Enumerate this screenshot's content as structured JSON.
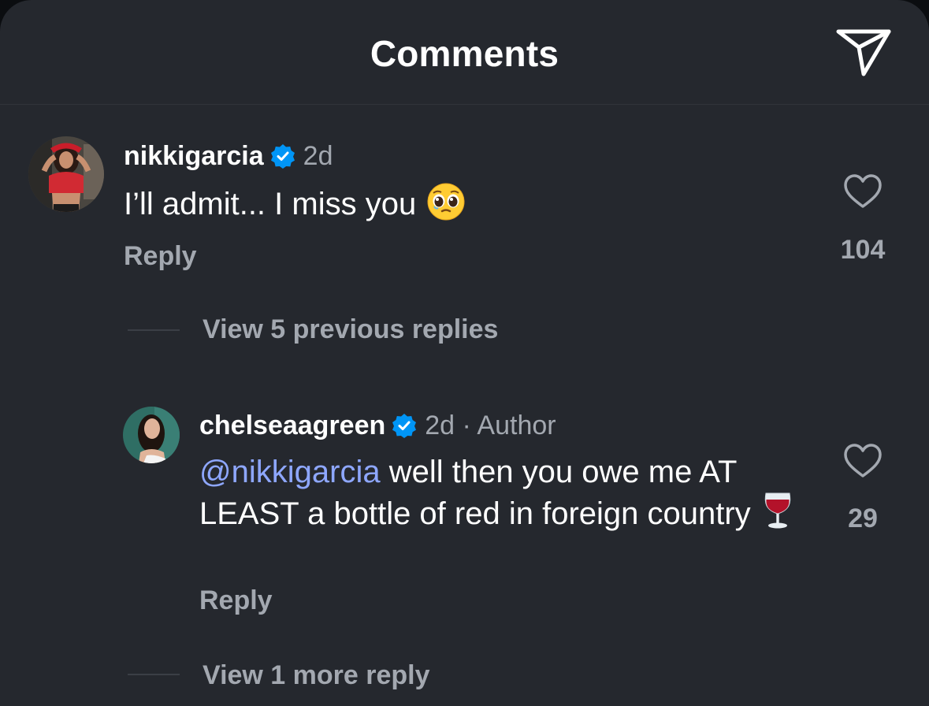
{
  "header": {
    "title": "Comments",
    "share_icon": "paper-plane-icon"
  },
  "comments": [
    {
      "username": "nikkigarcia",
      "verified": true,
      "time": "2d",
      "text": "I’ll admit... I miss you",
      "emoji": "pleading-face",
      "reply_label": "Reply",
      "likes": "104",
      "view_replies": "View 5 previous replies"
    },
    {
      "username": "chelseaagreen",
      "verified": true,
      "time": "2d · Author",
      "mention": "@nikkigarcia",
      "text": " well then you owe me AT LEAST a bottle of red in foreign country",
      "emoji": "wine-glass",
      "reply_label": "Reply",
      "likes": "29",
      "view_replies": "View 1 more reply"
    }
  ],
  "colors": {
    "background": "#25282e",
    "text": "#ffffff",
    "muted": "#a3a8b0",
    "mention": "#8ea7ff",
    "verified": "#0095f6"
  }
}
